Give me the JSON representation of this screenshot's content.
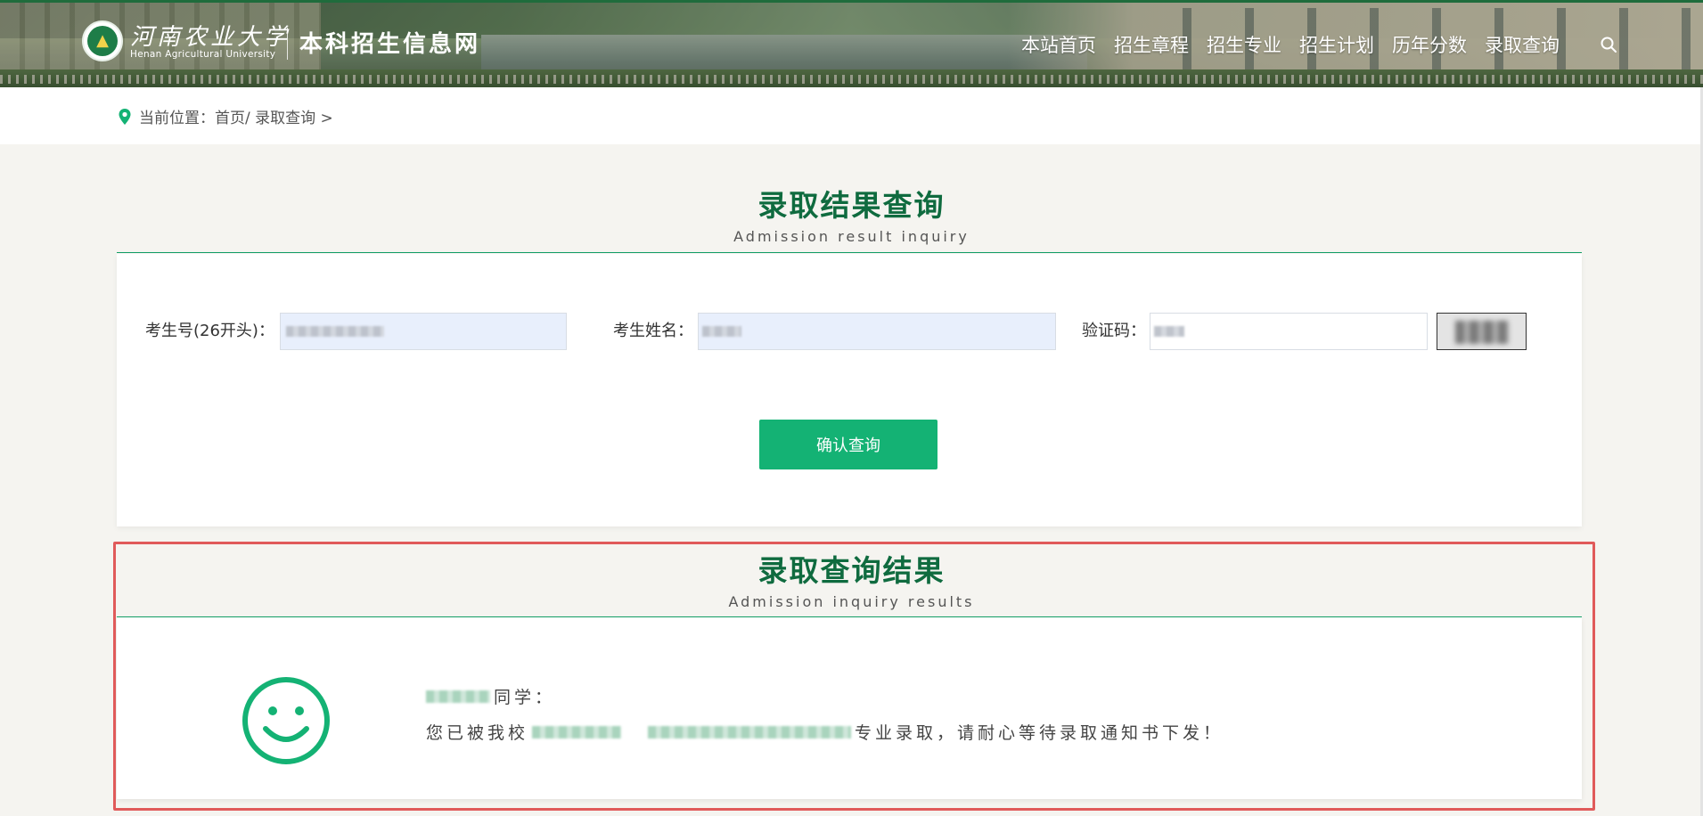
{
  "header": {
    "university_cn": "河南农业大学",
    "university_en": "Henan Agricultural University",
    "site_title": "本科招生信息网",
    "nav": [
      "本站首页",
      "招生章程",
      "招生专业",
      "招生计划",
      "历年分数",
      "录取查询"
    ],
    "search_icon": "search-icon"
  },
  "breadcrumb": {
    "text": "当前位置：首页/ 录取查询 >"
  },
  "query_section": {
    "title": "录取结果查询",
    "subtitle": "Admission result inquiry",
    "fields": {
      "exam_number_label": "考生号(26开头)：",
      "name_label": "考生姓名：",
      "captcha_label": "验证码："
    },
    "submit_label": "确认查询"
  },
  "result_section": {
    "title": "录取查询结果",
    "subtitle": "Admission inquiry results",
    "greeting_suffix": "同学：",
    "message_prefix": "您已被我校",
    "message_suffix": "专业录取，请耐心等待录取通知书下发！"
  },
  "colors": {
    "brand_green": "#0f6b3f",
    "button_green": "#14b274",
    "highlight_red": "#e05a5a"
  }
}
